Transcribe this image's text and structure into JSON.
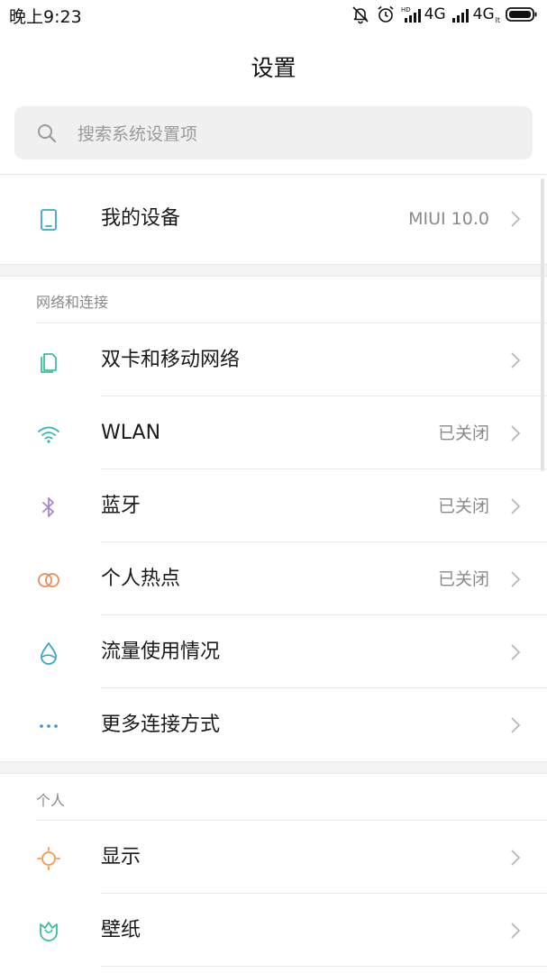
{
  "status_bar": {
    "time": "晚上9:23",
    "hd_label": "HD",
    "sim1_network": "4G",
    "sim2_network": "4G",
    "sim2_sup": "lt"
  },
  "header": {
    "title": "设置"
  },
  "search": {
    "placeholder": "搜索系统设置项"
  },
  "device": {
    "label": "我的设备",
    "value": "MIUI 10.0",
    "icon": "phone-icon"
  },
  "sections": {
    "network": {
      "title": "网络和连接",
      "items": [
        {
          "label": "双卡和移动网络",
          "value": "",
          "icon": "dual-sim-icon",
          "color": "#3dbf9e"
        },
        {
          "label": "WLAN",
          "value": "已关闭",
          "icon": "wifi-icon",
          "color": "#2fb6b9"
        },
        {
          "label": "蓝牙",
          "value": "已关闭",
          "icon": "bluetooth-icon",
          "color": "#a784d8"
        },
        {
          "label": "个人热点",
          "value": "已关闭",
          "icon": "hotspot-icon",
          "color": "#f08b5a"
        },
        {
          "label": "流量使用情况",
          "value": "",
          "icon": "data-drop-icon",
          "color": "#39a8c8"
        },
        {
          "label": "更多连接方式",
          "value": "",
          "icon": "more-dots-icon",
          "color": "#3a8fe0"
        }
      ]
    },
    "personal": {
      "title": "个人",
      "items": [
        {
          "label": "显示",
          "value": "",
          "icon": "sun-icon",
          "color": "#f29a4a"
        },
        {
          "label": "壁纸",
          "value": "",
          "icon": "tulip-icon",
          "color": "#3dbf9e"
        }
      ]
    }
  },
  "colors": {
    "accent_device": "#39a8c8",
    "chevron": "#b8b8b8",
    "secondary_text": "#8a8a8a"
  }
}
